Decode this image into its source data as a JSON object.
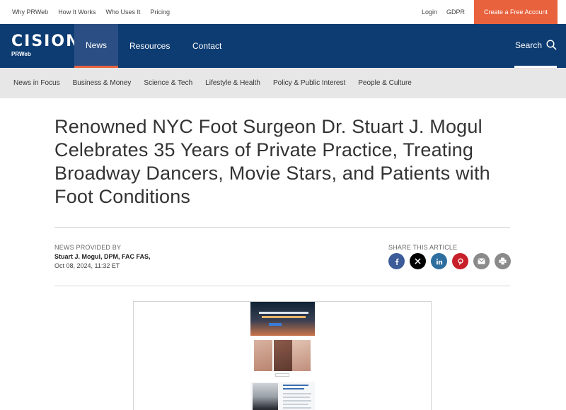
{
  "topbar": {
    "links": [
      "Why PRWeb",
      "How It Works",
      "Who Uses It",
      "Pricing"
    ],
    "login": "Login",
    "gdpr": "GDPR",
    "cta": "Create a Free Account"
  },
  "nav": {
    "logo_word": "CISION",
    "logo_tm": "®",
    "logo_sub": "PRWeb",
    "items": [
      "News",
      "Resources",
      "Contact"
    ],
    "active": "News",
    "search": "Search"
  },
  "categories": [
    "News in Focus",
    "Business & Money",
    "Science & Tech",
    "Lifestyle & Health",
    "Policy & Public Interest",
    "People & Culture"
  ],
  "article": {
    "headline": "Renowned NYC Foot Surgeon Dr. Stuart J. Mogul Celebrates 35 Years of Private Practice, Treating Broadway Dancers, Movie Stars, and Patients with Foot Conditions",
    "provided_label": "NEWS PROVIDED BY",
    "provider": "Stuart J. Mogul, DPM, FAC FAS,",
    "date": "Oct 08, 2024, 11:32 ET",
    "share_label": "SHARE THIS ARTICLE",
    "share_icons": [
      "facebook-icon",
      "x-icon",
      "linkedin-icon",
      "pinterest-icon",
      "email-icon",
      "print-icon"
    ]
  },
  "colors": {
    "nav_bg": "#0d3c72",
    "accent": "#e8623d",
    "category_bg": "#e7e7e7"
  }
}
